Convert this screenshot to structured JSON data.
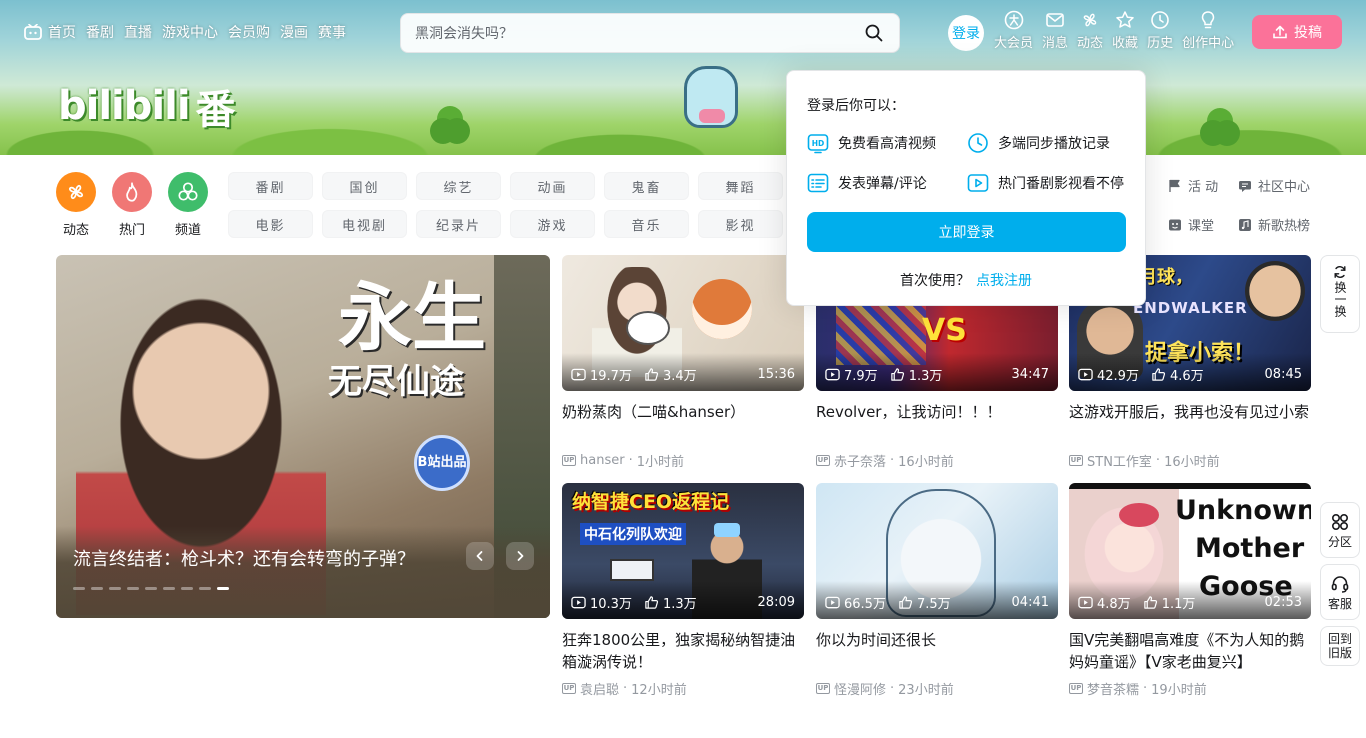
{
  "header": {
    "left_nav": [
      {
        "label": "首页",
        "icon": "tv-icon"
      },
      {
        "label": "番剧"
      },
      {
        "label": "直播"
      },
      {
        "label": "游戏中心"
      },
      {
        "label": "会员购"
      },
      {
        "label": "漫画"
      },
      {
        "label": "赛事"
      }
    ],
    "search": {
      "placeholder": "黑洞会消失吗？"
    },
    "login_label": "登录",
    "right_nav": [
      {
        "label": "大会员",
        "icon": "vip-icon"
      },
      {
        "label": "消息",
        "icon": "mail-icon"
      },
      {
        "label": "动态",
        "icon": "windmill-icon"
      },
      {
        "label": "收藏",
        "icon": "star-icon"
      },
      {
        "label": "历史",
        "icon": "clock-icon"
      },
      {
        "label": "创作中心",
        "icon": "bulb-icon"
      }
    ],
    "upload_label": "投稿"
  },
  "banner": {
    "logo_word": "bilibili",
    "logo_char": "番"
  },
  "channels": {
    "big": [
      {
        "label": "动态",
        "color": "#ff8c1a"
      },
      {
        "label": "热门",
        "color": "#f07775"
      },
      {
        "label": "频道",
        "color": "#3fbd6b"
      }
    ],
    "tags": [
      "番剧",
      "国创",
      "综艺",
      "动画",
      "鬼畜",
      "舞蹈",
      "电影",
      "电视剧",
      "纪录片",
      "游戏",
      "音乐",
      "影视"
    ],
    "right": [
      {
        "label": "活 动",
        "icon": "flag-icon"
      },
      {
        "label": "社区中心",
        "icon": "community-icon"
      },
      {
        "label": "课堂",
        "icon": "class-icon"
      },
      {
        "label": "新歌热榜",
        "icon": "music-icon"
      }
    ]
  },
  "carousel": {
    "caption": "流言终结者：枪斗术？还有会转弯的子弹？",
    "poster_big": "永生",
    "poster_small": "无尽仙途",
    "badge": "B站出品",
    "dot_count": 9,
    "active_dot": 8
  },
  "videos": [
    {
      "title": "奶粉蒸肉（二喵&hanser）",
      "views": "19.7万",
      "likes": "3.4万",
      "duration": "15:36",
      "up": "hanser",
      "time": "1小时前"
    },
    {
      "title": "Revolver，让我访问！！！",
      "views": "7.9万",
      "likes": "1.3万",
      "duration": "34:47",
      "up": "赤子奈落",
      "time": "16小时前"
    },
    {
      "title": "这游戏开服后，我再也没有见过小索",
      "views": "42.9万",
      "likes": "4.6万",
      "duration": "08:45",
      "up": "STN工作室",
      "time": "16小时前"
    },
    {
      "title": "狂奔1800公里，独家揭秘纳智捷油箱漩涡传说！",
      "views": "10.3万",
      "likes": "1.3万",
      "duration": "28:09",
      "up": "袁启聪",
      "time": "12小时前"
    },
    {
      "title": "你以为时间还很长",
      "views": "66.5万",
      "likes": "7.5万",
      "duration": "04:41",
      "up": "怪漫阿修",
      "time": "23小时前"
    },
    {
      "title": "国V完美翻唱高难度《不为人知的鹅妈妈童谣》【V家老曲复兴】",
      "views": "4.8万",
      "likes": "1.1万",
      "duration": "02:53",
      "up": "梦音茶糯",
      "time": "19小时前"
    }
  ],
  "thumb_text": {
    "v2_a": "VS",
    "v3_a": "月球，",
    "v3_b": "ENDWALKER",
    "v3_c": "捉拿小索！",
    "v4_a": "纳智捷CEO返程记",
    "v4_b": "中石化列队欢迎",
    "v6_a": "Unknown",
    "v6_b": "Mother",
    "v6_c": "Goose"
  },
  "side_buttons": {
    "refresh": "换一换",
    "category": "分区",
    "service": "客服",
    "old_version": "回到旧版"
  },
  "popup": {
    "title": "登录后你可以：",
    "benefits": [
      {
        "label": "免费看高清视频",
        "icon": "hd-icon"
      },
      {
        "label": "多端同步播放记录",
        "icon": "sync-clock-icon"
      },
      {
        "label": "发表弹幕/评论",
        "icon": "danmaku-icon"
      },
      {
        "label": "热门番剧影视看不停",
        "icon": "play-icon"
      }
    ],
    "login_button": "立即登录",
    "first_use": "首次使用？",
    "register_link": "点我注册"
  },
  "colors": {
    "brand_blue": "#00aeec",
    "brand_pink": "#fb7299"
  }
}
